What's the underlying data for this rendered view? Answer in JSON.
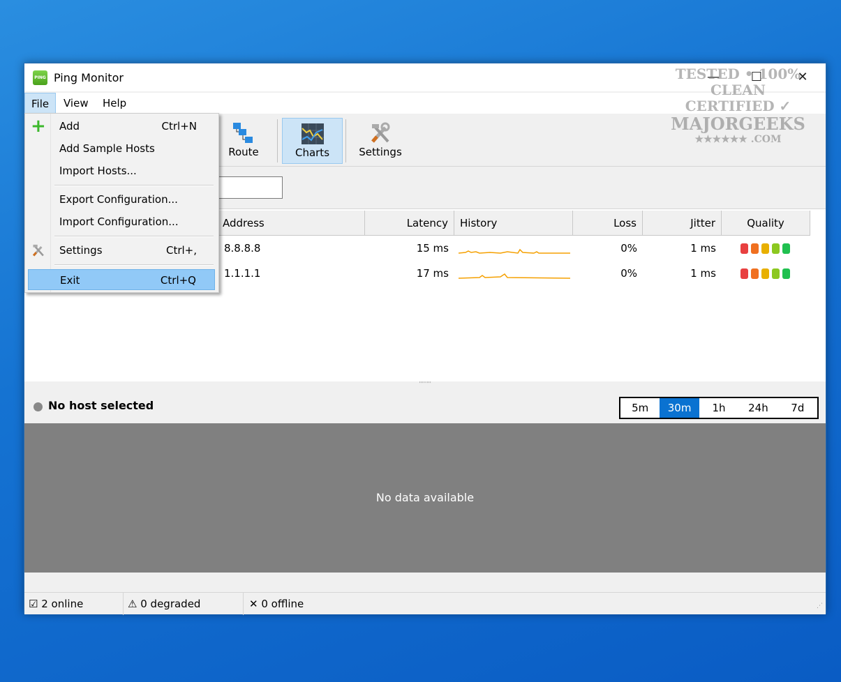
{
  "window": {
    "title": "Ping Monitor",
    "icon_text": "PING",
    "minimize": "—",
    "maximize": "☐",
    "close": "✕"
  },
  "watermark": {
    "line1": "TESTED • 100% CLEAN",
    "line2": "CERTIFIED",
    "line3": "MAJORGEEKS",
    "line4": "★★★★★★ .COM"
  },
  "menubar": [
    "File",
    "View",
    "Help"
  ],
  "file_menu": [
    {
      "label": "Add",
      "shortcut": "Ctrl+N",
      "icon": "plus-icon"
    },
    {
      "label": "Add Sample Hosts",
      "shortcut": ""
    },
    {
      "label": "Import Hosts...",
      "shortcut": ""
    },
    {
      "label": "Export Configuration...",
      "shortcut": ""
    },
    {
      "label": "Import Configuration...",
      "shortcut": ""
    },
    {
      "label": "Settings",
      "shortcut": "Ctrl+,",
      "icon": "tools-icon"
    },
    {
      "label": "Exit",
      "shortcut": "Ctrl+Q",
      "highlighted": true
    }
  ],
  "toolbar": {
    "route": "Route",
    "charts": "Charts",
    "settings": "Settings"
  },
  "table": {
    "columns": [
      "Address",
      "Latency",
      "History",
      "Loss",
      "Jitter",
      "Quality"
    ],
    "rows": [
      {
        "address": "8.8.8.8",
        "latency": "15 ms",
        "loss": "0%",
        "jitter": "1 ms"
      },
      {
        "address": "1.1.1.1",
        "latency": "17 ms",
        "loss": "0%",
        "jitter": "1 ms"
      }
    ],
    "quality_colors": [
      "#e84040",
      "#f07020",
      "#e8b000",
      "#8cc820",
      "#20c050"
    ],
    "history_color": "#f5a000"
  },
  "detail": {
    "host_label": "No host selected",
    "ranges": [
      "5m",
      "30m",
      "1h",
      "24h",
      "7d"
    ],
    "selected_range": "30m",
    "empty_text": "No data available"
  },
  "status": {
    "online": "2 online",
    "degraded": "0 degraded",
    "offline": "0 offline",
    "online_icon": "☑",
    "degraded_icon": "⚠",
    "offline_icon": "✕"
  }
}
